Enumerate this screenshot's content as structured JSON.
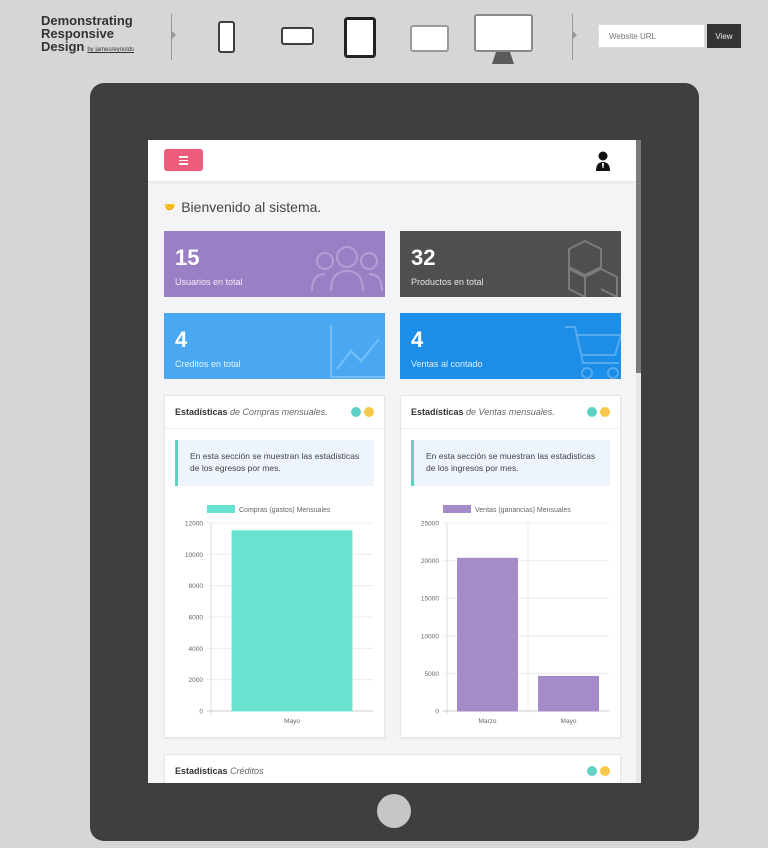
{
  "header": {
    "brand_line1": "Demonstrating",
    "brand_line2": "Responsive",
    "brand_line3": "Design",
    "brand_by": "by jamesreynolds",
    "url_placeholder": "Website URL",
    "view_label": "View"
  },
  "devices": [
    "phone-portrait-icon",
    "phone-landscape-icon",
    "tablet-portrait-icon",
    "tablet-landscape-icon",
    "desktop-icon"
  ],
  "app": {
    "welcome": "Bienvenido al sistema.",
    "stats": [
      {
        "value": "15",
        "label": "Usuarios en total",
        "color": "#9b7fc5"
      },
      {
        "value": "32",
        "label": "Productos en total",
        "color": "#4f4f4f"
      },
      {
        "value": "4",
        "label": "Creditos en total",
        "color": "#4aa8f2"
      },
      {
        "value": "4",
        "label": "Ventas al contado",
        "color": "#1d8ee8"
      }
    ],
    "cards": [
      {
        "title_bold": "Estadísticas",
        "title_italic": "de Compras mensuales.",
        "note": "En esta sección se muestran las estadisticas de los egresos por mes."
      },
      {
        "title_bold": "Estadísticas",
        "title_italic": "de Ventas mensuales.",
        "note": "En esta sección se muestran las estadisticas de los ingresos por mes."
      },
      {
        "title_bold": "Estadísticas",
        "title_italic": "Créditos"
      }
    ],
    "dot_colors": [
      "#5fd0c5",
      "#f6c94a"
    ]
  },
  "chart_data": [
    {
      "type": "bar",
      "categories": [
        "Mayo"
      ],
      "series": [
        {
          "name": "Compras (gastos) Mensuales",
          "values": [
            11500
          ],
          "color": "#69e3d0"
        }
      ],
      "ylim": [
        0,
        12000
      ],
      "yticks": [
        0,
        2000,
        4000,
        6000,
        8000,
        10000,
        12000
      ]
    },
    {
      "type": "bar",
      "categories": [
        "Marzo",
        "Mayo"
      ],
      "series": [
        {
          "name": "Ventas (ganancias) Mensuales",
          "values": [
            20300,
            4600
          ],
          "color": "#a58bc7"
        }
      ],
      "ylim": [
        0,
        25000
      ],
      "yticks": [
        0,
        5000,
        10000,
        15000,
        20000,
        25000
      ]
    }
  ]
}
